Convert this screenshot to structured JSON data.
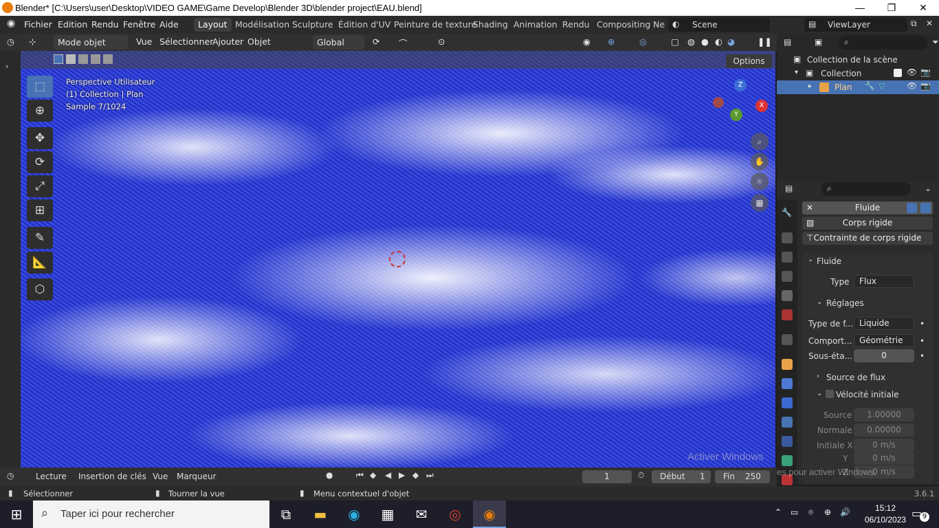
{
  "window": {
    "title": "Blender* [C:\\Users\\user\\Desktop\\VIDEO GAME\\Game Develop\\Blender 3D\\blender project\\EAU.blend]",
    "minimize": "—",
    "maximize": "❐",
    "close": "✕"
  },
  "menu": {
    "items": [
      "Fichier",
      "Edition",
      "Rendu",
      "Fenêtre",
      "Aide"
    ]
  },
  "workspaces": [
    "Layout",
    "Modélisation",
    "Sculpture",
    "Édition d'UV",
    "Peinture de texture",
    "Shading",
    "Animation",
    "Rendu",
    "Compositing",
    "Ne"
  ],
  "scene": {
    "name": "Scene",
    "view_layer": "ViewLayer"
  },
  "toolbar": {
    "mode": "Mode objet",
    "items": [
      "Vue",
      "Sélectionner",
      "Ajouter",
      "Objet"
    ],
    "transform": "Global"
  },
  "viewport": {
    "options_label": "Options",
    "info_lines": [
      "Perspective Utilisateur",
      "(1) Collection | Plan",
      "Sample 7/1024"
    ],
    "gizmo_z": "Z",
    "gizmo_y": "Y",
    "gizmo_x": "X"
  },
  "outliner": {
    "root": "Collection de la scène",
    "collection": "Collection",
    "object": "Plan"
  },
  "properties": {
    "modifier_header": "Fluide",
    "buttons": [
      "Corps rigide",
      "Contrainte de corps rigide"
    ],
    "panel_title": "Fluide",
    "type_label": "Type",
    "type_value": "Flux",
    "settings_label": "Réglages",
    "flow_type_label": "Type de f...",
    "flow_type_value": "Liquide",
    "behavior_label": "Comport...",
    "behavior_value": "Géométrie",
    "substeps_label": "Sous-éta...",
    "substeps_value": "0",
    "flow_source": "Source de flux",
    "initial_velocity": "Vélocité initiale",
    "source_label": "Source",
    "source_value": "1.00000",
    "normal_label": "Normale",
    "normal_value": "0.00000",
    "initial_x_label": "Initiale X",
    "initial_x_value": "0 m/s",
    "y_label": "Y",
    "y_value": "0 m/s",
    "z_label": "Z",
    "z_value": "0 m/s"
  },
  "watermark": {
    "line1": "Activer Windows",
    "line2": "Accédez aux paramètres pour activer Windows."
  },
  "timeline": {
    "items": [
      "Lecture",
      "Insertion de clés",
      "Vue",
      "Marqueur"
    ],
    "current_frame": "1",
    "start_label": "Début",
    "start_value": "1",
    "end_label": "Fin",
    "end_value": "250"
  },
  "status": {
    "select": "Sélectionner",
    "rotate": "Tourner la vue",
    "context": "Menu contextuel d'objet",
    "version": "3.6.1"
  },
  "taskbar": {
    "search_placeholder": "Taper ici pour rechercher",
    "time": "15:12",
    "date": "06/10/2023",
    "notif_count": "9"
  }
}
